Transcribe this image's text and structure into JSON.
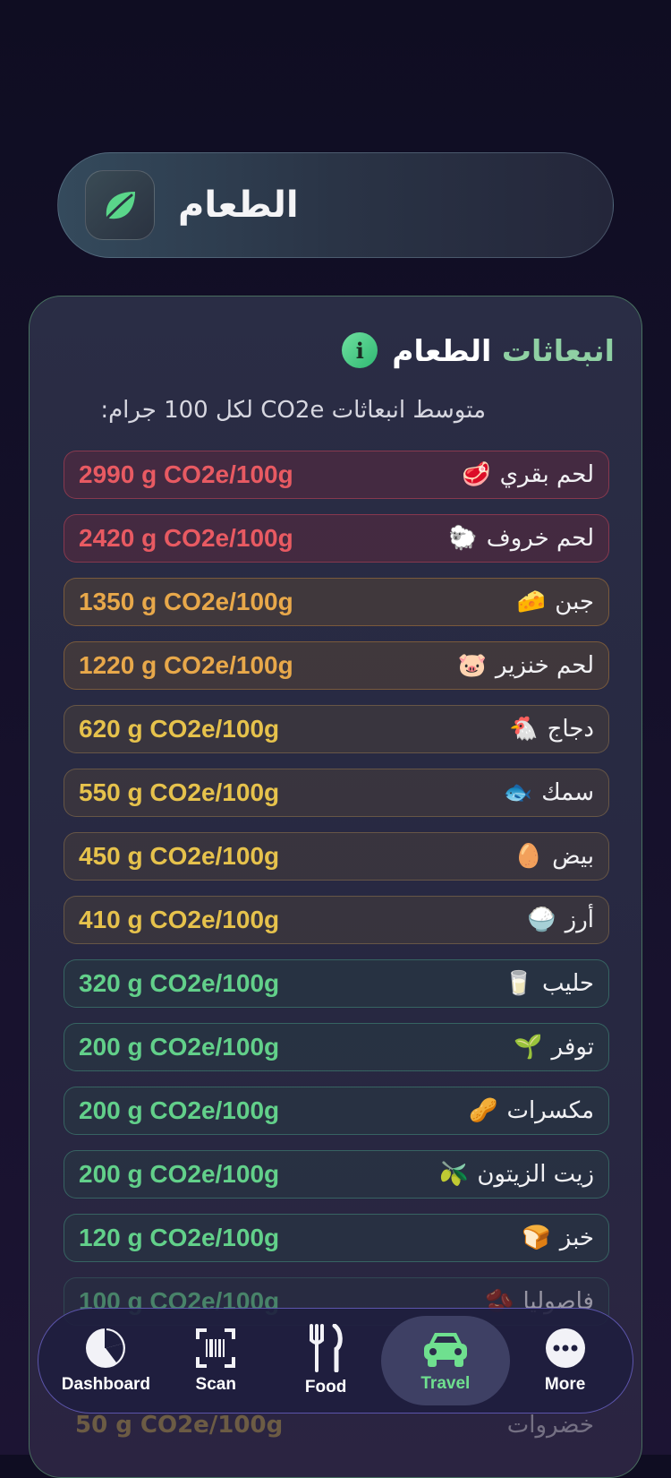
{
  "header": {
    "title": "الطعام",
    "icon": "leaf-icon"
  },
  "card": {
    "title_part1": "انبعاثات",
    "title_part2": "الطعام",
    "subtitle": "متوسط انبعاثات CO2e لكل 100 جرام:",
    "items": [
      {
        "name": "لحم بقري",
        "emoji": "🥩",
        "value": "2990 g CO2e/100g",
        "level": "red"
      },
      {
        "name": "لحم خروف",
        "emoji": "🐑",
        "value": "2420 g CO2e/100g",
        "level": "red"
      },
      {
        "name": "جبن",
        "emoji": "🧀",
        "value": "1350 g CO2e/100g",
        "level": "orange"
      },
      {
        "name": "لحم خنزير",
        "emoji": "🐷",
        "value": "1220 g CO2e/100g",
        "level": "orange"
      },
      {
        "name": "دجاج",
        "emoji": "🐔",
        "value": "620 g CO2e/100g",
        "level": "yellow"
      },
      {
        "name": "سمك",
        "emoji": "🐟",
        "value": "550 g CO2e/100g",
        "level": "yellow"
      },
      {
        "name": "بيض",
        "emoji": "🥚",
        "value": "450 g CO2e/100g",
        "level": "yellow"
      },
      {
        "name": "أرز",
        "emoji": "🍚",
        "value": "410 g CO2e/100g",
        "level": "yellow"
      },
      {
        "name": "حليب",
        "emoji": "🥛",
        "value": "320 g CO2e/100g",
        "level": "green"
      },
      {
        "name": "توفر",
        "emoji": "🌱",
        "value": "200 g CO2e/100g",
        "level": "green"
      },
      {
        "name": "مكسرات",
        "emoji": "🥜",
        "value": "200 g CO2e/100g",
        "level": "green"
      },
      {
        "name": "زيت الزيتون",
        "emoji": "🫒",
        "value": "200 g CO2e/100g",
        "level": "green"
      },
      {
        "name": "خبز",
        "emoji": "🍞",
        "value": "120 g CO2e/100g",
        "level": "green"
      },
      {
        "name": "فاصوليا",
        "emoji": "🫘",
        "value": "100 g CO2e/100g",
        "level": "green"
      }
    ]
  },
  "footer_partial": {
    "name": "خضروات",
    "value": "50 g CO2e/100g"
  },
  "nav": {
    "items": [
      {
        "label": "Dashboard",
        "icon": "pie-chart-icon",
        "active": false
      },
      {
        "label": "Scan",
        "icon": "barcode-scan-icon",
        "active": false
      },
      {
        "label": "Food",
        "icon": "fork-knife-icon",
        "active": false
      },
      {
        "label": "Travel",
        "icon": "car-icon",
        "active": true
      },
      {
        "label": "More",
        "icon": "more-dots-icon",
        "active": false
      }
    ]
  },
  "colors": {
    "accent_green": "#62d08a",
    "red": "#e85a62",
    "orange": "#e8a84a",
    "yellow": "#e6c24c",
    "nav_border": "#7a6edc"
  }
}
